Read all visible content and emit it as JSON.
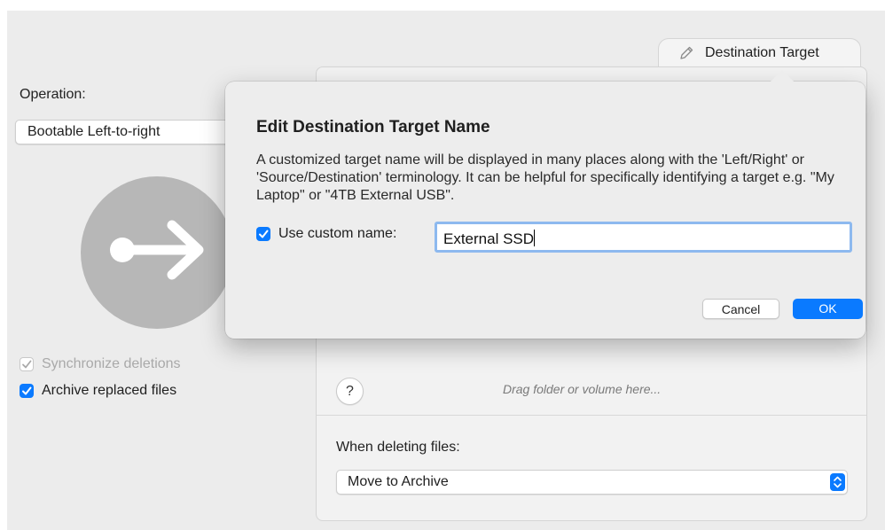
{
  "left": {
    "operation_label": "Operation:",
    "operation_value": "Bootable Left-to-right",
    "sync_deletions_label": "Synchronize deletions",
    "archive_replaced_label": "Archive replaced files"
  },
  "tab": {
    "label": "Destination Target",
    "icon": "pencil-icon"
  },
  "panel": {
    "help_label": "?",
    "drag_hint": "Drag folder or volume here...",
    "deleting_label": "When deleting files:",
    "deleting_value": "Move to Archive"
  },
  "dialog": {
    "title": "Edit Destination Target Name",
    "description": "A customized target name will be displayed in many places along with the 'Left/Right' or 'Source/Destination' terminology. It can be helpful for specifically identifying a target e.g. \"My Laptop\" or \"4TB External USB\".",
    "use_custom_label": "Use custom name:",
    "custom_name_value": "External SSD",
    "cancel_label": "Cancel",
    "ok_label": "OK"
  },
  "colors": {
    "accent": "#0a7aff",
    "focus_ring": "#8db9ef",
    "circle": "#b7b7b7"
  }
}
